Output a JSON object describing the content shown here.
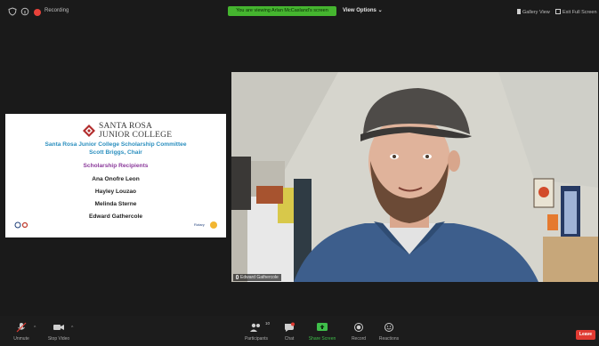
{
  "topbar": {
    "recording_label": "Recording",
    "share_banner": "You are viewing Arlan McCasland's screen",
    "view_options": "View Options ⌄",
    "gallery_view": "Gallery View",
    "exit_full_screen": "Exit Full Screen"
  },
  "slide": {
    "logo_line1": "SANTA ROSA",
    "logo_line2": "JUNIOR COLLEGE",
    "committee": "Santa Rosa Junior College Scholarship Committee",
    "chair": "Scott Briggs, Chair",
    "recipients_heading": "Scholarship Recipients",
    "names": [
      "Ana Onofre Leon",
      "Hayley Louzao",
      "Melinda Sterne",
      "Edward Gathercole"
    ],
    "rotary_label": "Rotary"
  },
  "video": {
    "participant_name": "Edward Gathercole"
  },
  "toolbar": {
    "unmute": "Unmute",
    "stop_video": "Stop Video",
    "participants": "Participants",
    "participants_count": "10",
    "chat": "Chat",
    "share_screen": "Share Screen",
    "record": "Record",
    "reactions": "Reactions",
    "leave": "Leave"
  },
  "colors": {
    "banner_green": "#45b52f",
    "leave_red": "#e03a32",
    "share_green": "#3fbf4a",
    "committee_blue": "#2b8fbf",
    "recipients_purple": "#8b3a9b"
  }
}
